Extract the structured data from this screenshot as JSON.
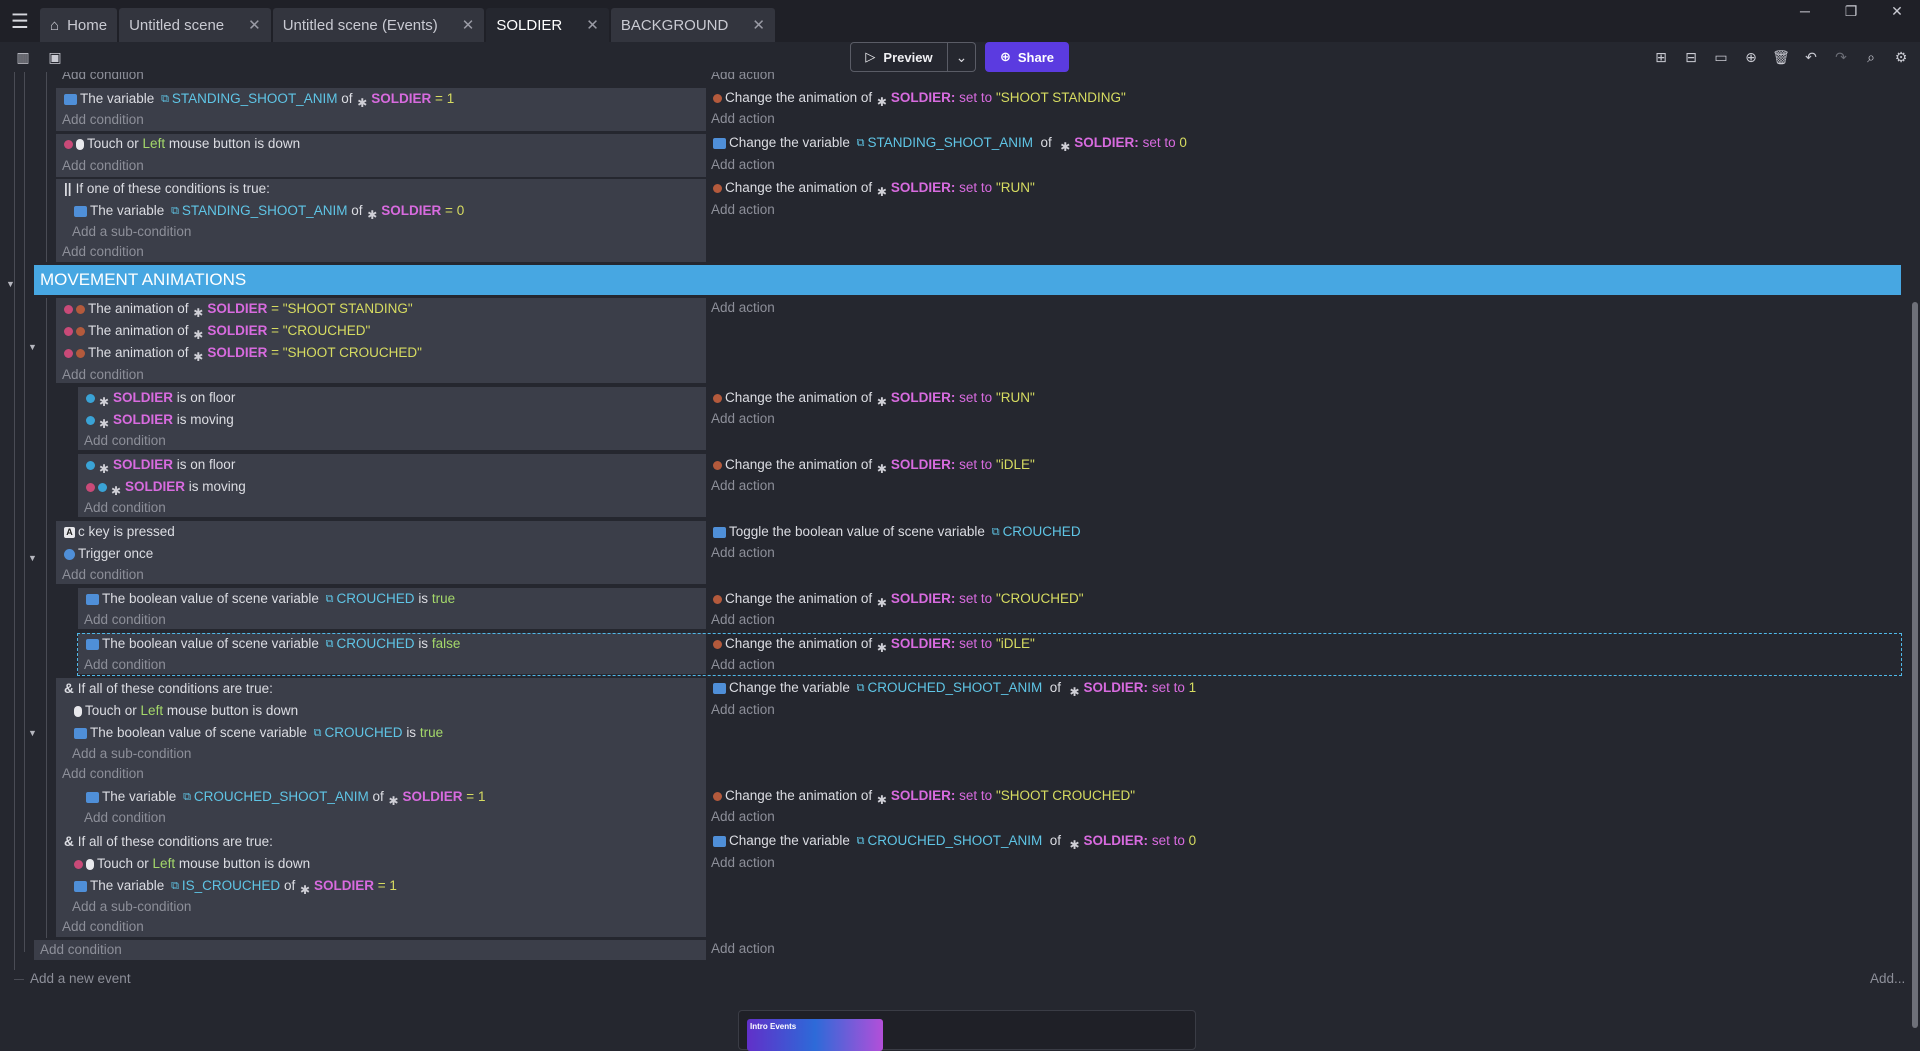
{
  "tabs": [
    {
      "label": "Home"
    },
    {
      "label": "Untitled scene"
    },
    {
      "label": "Untitled scene (Events)"
    },
    {
      "label": "SOLDIER"
    },
    {
      "label": "BACKGROUND"
    }
  ],
  "toolbar": {
    "preview": "Preview",
    "share": "Share"
  },
  "common": {
    "add_condition": "Add condition",
    "add_action": "Add action",
    "add_sub_condition": "Add a sub-condition",
    "add_new_event": "Add a new event",
    "add_menu": "Add..."
  },
  "group": {
    "title": "MOVEMENT ANIMATIONS"
  },
  "words": {
    "the_variable": "The variable",
    "of": "of",
    "eq": "=",
    "set_to": "set to",
    "change_anim": "Change the animation of",
    "change_var": "Change the variable",
    "soldier": "SOLDIER",
    "soldier_colon": "SOLDIER:",
    "touch_or": "Touch or",
    "left": "Left",
    "mouse_down": "mouse button is down",
    "any_true": "If one of these conditions is true:",
    "all_true": "If all of these conditions are true:",
    "anim_of": "The animation of",
    "is_on_floor": "is on floor",
    "is_moving": "is moving",
    "c_key": "c key is pressed",
    "trigger_once": "Trigger once",
    "toggle_bool": "Toggle the boolean value of scene variable",
    "bool_value": "The boolean value of scene variable",
    "is": "is",
    "true": "true",
    "false": "false"
  },
  "vars": {
    "standing": "STANDING_SHOOT_ANIM",
    "crouched": "CROUCHED",
    "crouched_shoot": "CROUCHED_SHOOT_ANIM",
    "is_crouched": "IS_CROUCHED"
  },
  "values": {
    "one": "1",
    "zero": "0",
    "shoot_standing": "\"SHOOT STANDING\"",
    "run": "\"RUN\"",
    "crouched": "\"CROUCHED\"",
    "shoot_crouched": "\"SHOOT CROUCHED\"",
    "idle": "\"iDLE\""
  },
  "popup": {
    "label": "Intro Events"
  }
}
